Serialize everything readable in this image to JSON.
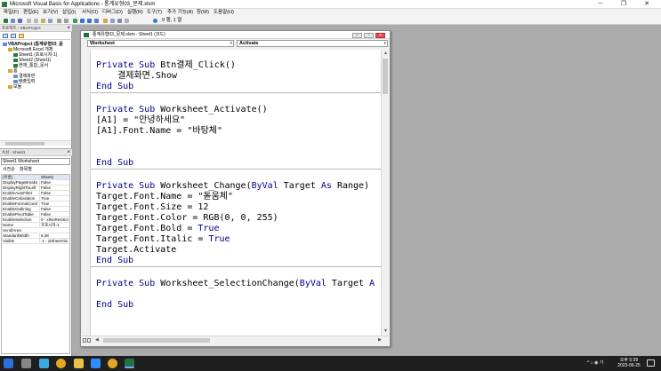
{
  "window": {
    "title": "Microsoft Visual Basic for Applications - 통계유형03_문제.xlsm",
    "controls": [
      "─",
      "❐",
      "✕"
    ]
  },
  "menubar": [
    "파일(F)",
    "편집(E)",
    "보기(V)",
    "삽입(I)",
    "서식(O)",
    "디버그(D)",
    "실행(R)",
    "도구(T)",
    "추가 기능(A)",
    "창(W)",
    "도움말(H)"
  ],
  "toolbar": {
    "position": "9 행, 1 열"
  },
  "project_explorer": {
    "title": "프로젝트 - VBAProject",
    "tree": [
      {
        "label": "VBAProject (통계유형03_문",
        "level": 0,
        "bold": true
      },
      {
        "label": "Microsoft Excel 개체",
        "level": 1
      },
      {
        "label": "Sheet1 (프로시저-1)",
        "level": 2
      },
      {
        "label": "Sheet2 (Sheet1)",
        "level": 2
      },
      {
        "label": "현재_통합_문서",
        "level": 2
      },
      {
        "label": "폼",
        "level": 1
      },
      {
        "label": "결제화면",
        "level": 2
      },
      {
        "label": "배출입력",
        "level": 2
      },
      {
        "label": "모듈",
        "level": 1
      }
    ]
  },
  "properties": {
    "title": "속성 - Sheet1",
    "object": "Sheet1  Worksheet",
    "tabs": [
      "사전순",
      "항목별"
    ],
    "rows": [
      {
        "name": "(이름)",
        "value": "Sheet1"
      },
      {
        "name": "DisplayPageBreaks",
        "value": "False"
      },
      {
        "name": "DisplayRightToLeft",
        "value": "False"
      },
      {
        "name": "EnableAutoFilter",
        "value": "False"
      },
      {
        "name": "EnableCalculation",
        "value": "True"
      },
      {
        "name": "EnableFormatCond",
        "value": "True"
      },
      {
        "name": "EnableOutlining",
        "value": "False"
      },
      {
        "name": "EnablePivotTable",
        "value": "False"
      },
      {
        "name": "EnableSelection",
        "value": "0 - xlNoRestrict"
      },
      {
        "name": "Name",
        "value": "프로시저-1"
      },
      {
        "name": "ScrollArea",
        "value": ""
      },
      {
        "name": "StandardWidth",
        "value": "8.38"
      },
      {
        "name": "Visible",
        "value": "-1 - xlSheetVisi"
      }
    ]
  },
  "code_window": {
    "title": "통계유형03_문제.xlsm - Sheet1 (코드)",
    "object_combo": "Worksheet",
    "procedure_combo": "Activate",
    "procedures": [
      {
        "lines": [
          [
            {
              "t": "Private Sub ",
              "k": true
            },
            {
              "t": "Btn결제_Click()"
            }
          ],
          [
            {
              "t": "    결제화면.Show"
            }
          ],
          [
            {
              "t": "End Sub",
              "k": true
            }
          ]
        ]
      },
      {
        "lines": [
          [
            {
              "t": "Private Sub ",
              "k": true
            },
            {
              "t": "Worksheet_Activate()"
            }
          ],
          [
            {
              "t": "[A1] = \"안녕하세요\""
            }
          ],
          [
            {
              "t": "[A1].Font.Name = \"바탕체\""
            }
          ],
          [
            {
              "t": ""
            }
          ],
          [
            {
              "t": ""
            }
          ],
          [
            {
              "t": "End Sub",
              "k": true
            }
          ]
        ]
      },
      {
        "lines": [
          [
            {
              "t": "Private Sub ",
              "k": true
            },
            {
              "t": "Worksheet_Change("
            },
            {
              "t": "ByVal",
              "k": true
            },
            {
              "t": " Target "
            },
            {
              "t": "As",
              "k": true
            },
            {
              "t": " Range)"
            }
          ],
          [
            {
              "t": "Target.Font.Name = \"돋움체\""
            }
          ],
          [
            {
              "t": "Target.Font.Size = 12"
            }
          ],
          [
            {
              "t": "Target.Font.Color = RGB(0, 0, 255)"
            }
          ],
          [
            {
              "t": "Target.Font.Bold = "
            },
            {
              "t": "True",
              "k": true
            }
          ],
          [
            {
              "t": "Target.Font.Italic = "
            },
            {
              "t": "True",
              "k": true
            }
          ],
          [
            {
              "t": "Target.Activate"
            }
          ],
          [
            {
              "t": "End Sub",
              "k": true
            }
          ]
        ]
      },
      {
        "lines": [
          [
            {
              "t": "Private Sub ",
              "k": true
            },
            {
              "t": "Worksheet_SelectionChange("
            },
            {
              "t": "ByVal",
              "k": true
            },
            {
              "t": " Target "
            },
            {
              "t": "A",
              "k": true
            }
          ],
          [
            {
              "t": ""
            }
          ],
          [
            {
              "t": "End Sub",
              "k": true
            }
          ]
        ]
      }
    ]
  },
  "taskbar": {
    "systray": "^  ⌂ ◉ 가",
    "time": "오후 5:39",
    "date": "2023-06-25"
  },
  "colors": {
    "keyword": "#00008b",
    "code_bg": "#ffffff",
    "taskbar": "#1f1f1f"
  }
}
